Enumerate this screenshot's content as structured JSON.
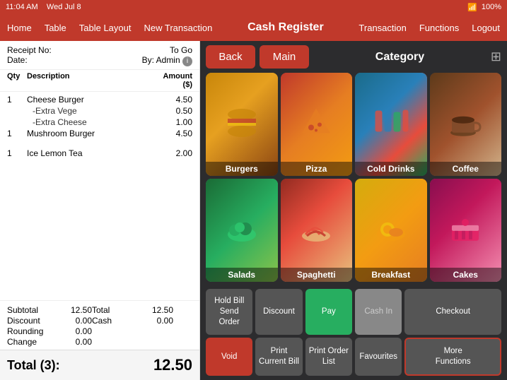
{
  "statusBar": {
    "time": "11:04 AM",
    "date": "Wed Jul 8",
    "wifi": "WiFi",
    "battery": "100%"
  },
  "navBar": {
    "title": "Cash Register",
    "leftItems": [
      "Home",
      "Table",
      "Table Layout",
      "New Transaction"
    ],
    "rightItems": [
      "Transaction",
      "Functions",
      "Logout"
    ]
  },
  "receipt": {
    "receiptLabel": "Receipt No:",
    "toGoLabel": "To Go",
    "dateLabel": "Date:",
    "byLabel": "By: Admin",
    "columns": {
      "qty": "Qty",
      "description": "Description",
      "amount": "Amount ($)"
    },
    "items": [
      {
        "qty": "1",
        "desc": "Cheese Burger",
        "amount": "4.50",
        "modifiers": [
          "-Extra Vege 0.50",
          "-Extra Cheese 1.00"
        ]
      },
      {
        "qty": "1",
        "desc": "Mushroom Burger",
        "amount": "4.50",
        "modifiers": []
      },
      {
        "qty": "",
        "desc": "",
        "amount": "",
        "modifiers": []
      },
      {
        "qty": "1",
        "desc": "Ice Lemon Tea",
        "amount": "2.00",
        "modifiers": []
      }
    ],
    "subtotal": "12.50",
    "discount": "0.00",
    "rounding": "0.00",
    "change": "0.00",
    "total": "12.50",
    "totalLabel": "Total (3):",
    "totalCash": "0.00",
    "subtotalLabel": "Subtotal",
    "discountLabel": "Discount",
    "roundingLabel": "Rounding",
    "changeLabel": "Change",
    "totalSummaryLabel": "Total",
    "cashLabel": "Cash"
  },
  "category": {
    "title": "Category",
    "backLabel": "Back",
    "mainLabel": "Main",
    "items": [
      {
        "id": "burgers",
        "label": "Burgers",
        "colorClass": "food-burgers"
      },
      {
        "id": "pizza",
        "label": "Pizza",
        "colorClass": "food-pizza"
      },
      {
        "id": "cold-drinks",
        "label": "Cold Drinks",
        "colorClass": "food-cold-drinks"
      },
      {
        "id": "coffee",
        "label": "Coffee",
        "colorClass": "food-coffee"
      },
      {
        "id": "salads",
        "label": "Salads",
        "colorClass": "food-salads"
      },
      {
        "id": "spaghetti",
        "label": "Spaghetti",
        "colorClass": "food-spaghetti"
      },
      {
        "id": "breakfast",
        "label": "Breakfast",
        "colorClass": "food-breakfast"
      },
      {
        "id": "cakes",
        "label": "Cakes",
        "colorClass": "food-cakes"
      }
    ]
  },
  "actionButtons": {
    "row1": [
      {
        "id": "hold-bill",
        "label": "Hold Bill\nSend Order",
        "style": "normal"
      },
      {
        "id": "discount",
        "label": "Discount",
        "style": "normal"
      },
      {
        "id": "pay",
        "label": "Pay",
        "style": "green"
      },
      {
        "id": "cash-in",
        "label": "Cash In",
        "style": "disabled"
      },
      {
        "id": "checkout",
        "label": "Checkout",
        "style": "normal"
      }
    ],
    "row2": [
      {
        "id": "void",
        "label": "Void",
        "style": "red"
      },
      {
        "id": "print-current-bill",
        "label": "Print\nCurrent Bill",
        "style": "normal"
      },
      {
        "id": "print-order-list",
        "label": "Print Order\nList",
        "style": "normal"
      },
      {
        "id": "favourites",
        "label": "Favourites",
        "style": "normal"
      },
      {
        "id": "more-functions",
        "label": "More\nFunctions",
        "style": "outlined"
      }
    ]
  }
}
